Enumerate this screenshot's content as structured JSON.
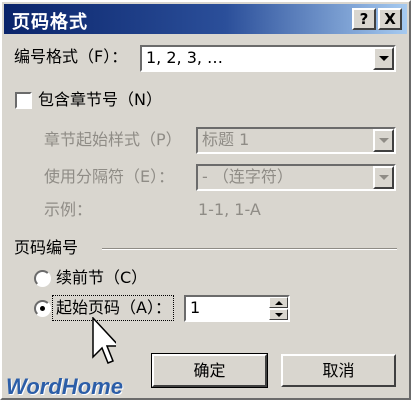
{
  "dialog": {
    "title": "页码格式",
    "help_button": "?",
    "close_button": "X"
  },
  "number_format": {
    "label": "编号格式（F）：",
    "value": "1, 2, 3, …"
  },
  "include_chapter": {
    "label": "包含章节号（N）",
    "checked": false
  },
  "chapter_start_style": {
    "label": "章节起始样式（P）",
    "value": "标题 1"
  },
  "separator": {
    "label": "使用分隔符（E）：",
    "value": "-  （连字符）"
  },
  "example": {
    "label": "示例：",
    "value": "1-1, 1-A"
  },
  "page_numbering": {
    "section_title": "页码编号",
    "continue_option": "续前节（C）",
    "start_at_option": "起始页码（A）：",
    "start_at_value": "1",
    "selected": "start_at"
  },
  "buttons": {
    "ok": "确定",
    "cancel": "取消"
  },
  "watermark": {
    "text": "WordHome"
  },
  "colors": {
    "title_bar": "#0a246a",
    "dialog_face": "#d9d6cf",
    "watermark": "#2c5ea8"
  }
}
